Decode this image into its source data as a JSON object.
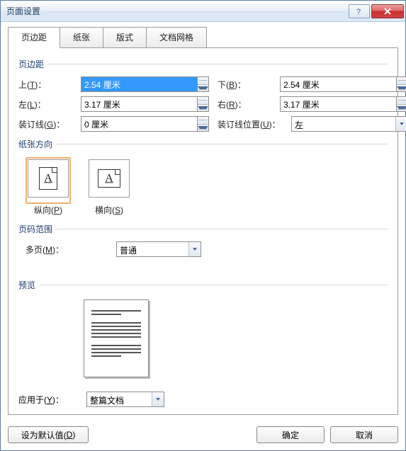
{
  "title": "页面设置",
  "tabs": [
    {
      "label": "页边距",
      "active": true
    },
    {
      "label": "纸张",
      "active": false
    },
    {
      "label": "版式",
      "active": false
    },
    {
      "label": "文档网格",
      "active": false
    }
  ],
  "margins": {
    "group_label": "页边距",
    "top": {
      "label_pre": "上(",
      "hotkey": "T",
      "label_post": ")：",
      "value": "2.54 厘米",
      "selected": true
    },
    "bottom": {
      "label_pre": "下(",
      "hotkey": "B",
      "label_post": ")：",
      "value": "2.54 厘米"
    },
    "left": {
      "label_pre": "左(",
      "hotkey": "L",
      "label_post": ")：",
      "value": "3.17 厘米"
    },
    "right": {
      "label_pre": "右(",
      "hotkey": "R",
      "label_post": ")：",
      "value": "3.17 厘米"
    },
    "gutter": {
      "label_pre": "装订线(",
      "hotkey": "G",
      "label_post": ")：",
      "value": "0 厘米"
    },
    "gutter_pos": {
      "label_pre": "装订线位置(",
      "hotkey": "U",
      "label_post": ")：",
      "value": "左"
    }
  },
  "orientation": {
    "group_label": "纸张方向",
    "portrait": {
      "label_pre": "纵向(",
      "hotkey": "P",
      "label_post": ")",
      "selected": true
    },
    "landscape": {
      "label_pre": "横向(",
      "hotkey": "S",
      "label_post": ")",
      "selected": false
    }
  },
  "page_range": {
    "group_label": "页码范围",
    "multi": {
      "label_pre": "多页(",
      "hotkey": "M",
      "label_post": ")：",
      "value": "普通"
    }
  },
  "preview": {
    "group_label": "预览"
  },
  "apply_to": {
    "label_pre": "应用于(",
    "hotkey": "Y",
    "label_post": ")：",
    "value": "整篇文档"
  },
  "buttons": {
    "set_default_pre": "设为默认值(",
    "set_default_hotkey": "D",
    "set_default_post": ")",
    "ok": "确定",
    "cancel": "取消"
  }
}
